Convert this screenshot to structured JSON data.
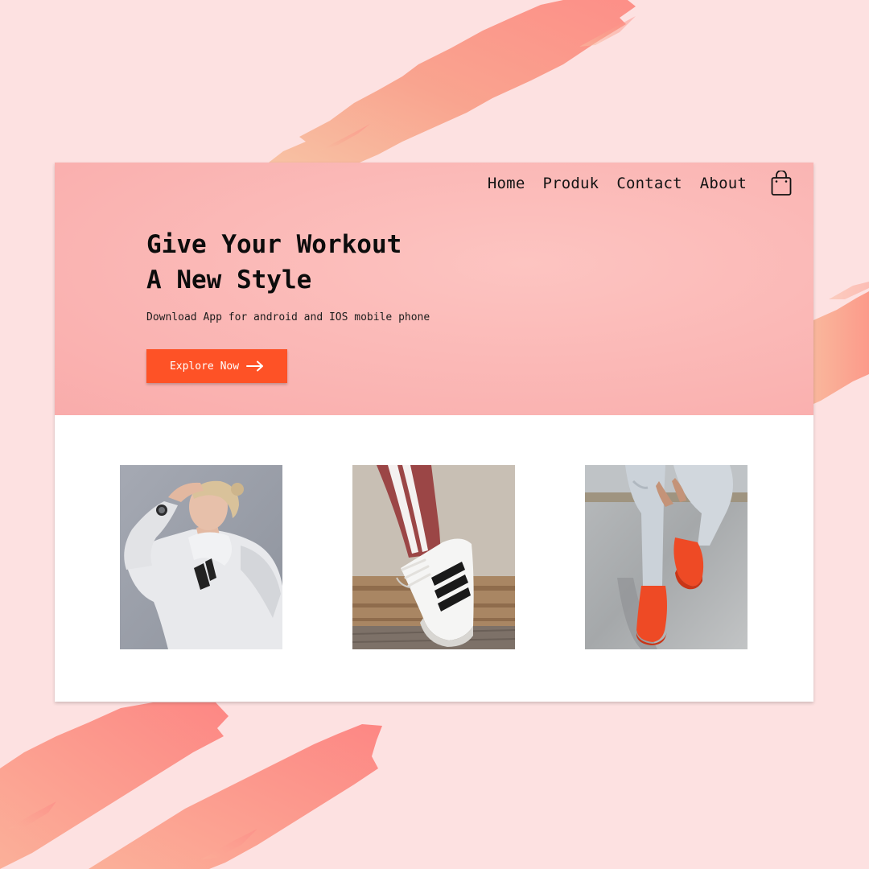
{
  "nav": {
    "items": [
      {
        "label": "Home"
      },
      {
        "label": "Produk"
      },
      {
        "label": "Contact"
      },
      {
        "label": "About"
      }
    ],
    "cart_icon": "shopping-bag-icon"
  },
  "hero": {
    "title_line1": "Give Your Workout",
    "title_line2": "A New Style",
    "subtitle": "Download App for android and IOS mobile phone",
    "cta_label": "Explore Now",
    "cta_icon": "arrow-right-icon"
  },
  "gallery": {
    "images": [
      {
        "subject": "woman in white hoodie"
      },
      {
        "subject": "white sneaker with black stripes"
      },
      {
        "subject": "red sneakers and ripped jeans"
      }
    ]
  },
  "colors": {
    "page_bg": "#fde1e1",
    "hero_bg": "#fbb9b7",
    "cta_bg": "#fe5226",
    "brush": "#fc8c85"
  }
}
